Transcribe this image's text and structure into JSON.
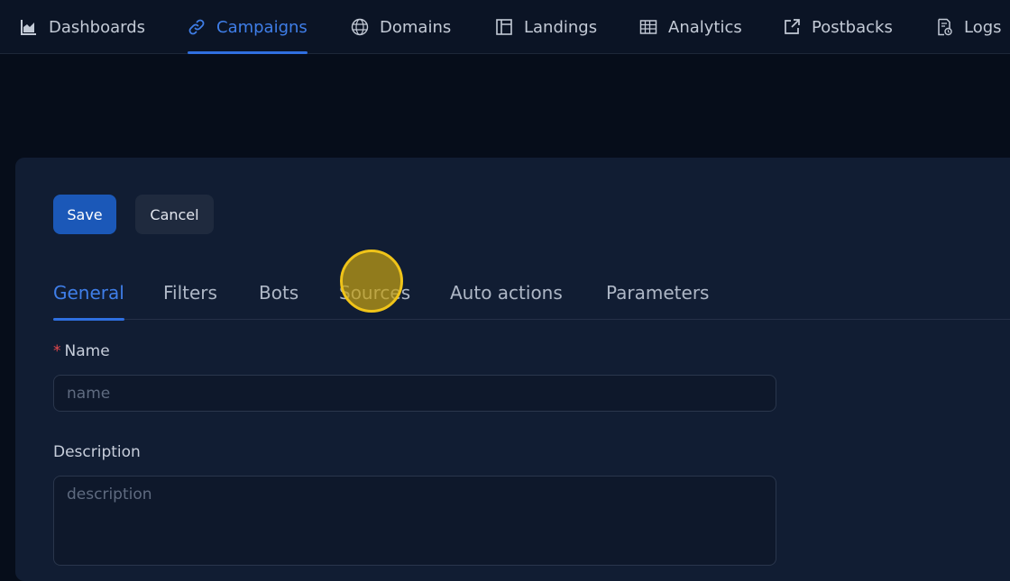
{
  "nav": {
    "items": [
      {
        "label": "Dashboards",
        "icon": "chart-icon"
      },
      {
        "label": "Campaigns",
        "icon": "link-icon",
        "active": true
      },
      {
        "label": "Domains",
        "icon": "globe-icon"
      },
      {
        "label": "Landings",
        "icon": "layout-icon"
      },
      {
        "label": "Analytics",
        "icon": "table-icon"
      },
      {
        "label": "Postbacks",
        "icon": "external-link-icon"
      },
      {
        "label": "Logs",
        "icon": "log-file-icon"
      }
    ]
  },
  "form": {
    "save_label": "Save",
    "cancel_label": "Cancel",
    "tabs": [
      {
        "label": "General",
        "active": true
      },
      {
        "label": "Filters"
      },
      {
        "label": "Bots"
      },
      {
        "label": "Sources"
      },
      {
        "label": "Auto actions"
      },
      {
        "label": "Parameters"
      }
    ],
    "name": {
      "required_mark": "*",
      "label": "Name",
      "placeholder": "name",
      "value": ""
    },
    "description": {
      "label": "Description",
      "placeholder": "description",
      "value": ""
    }
  },
  "colors": {
    "accent": "#3f7ee8",
    "save_button": "#1b58b8",
    "cursor_highlight": "#f0c419"
  }
}
